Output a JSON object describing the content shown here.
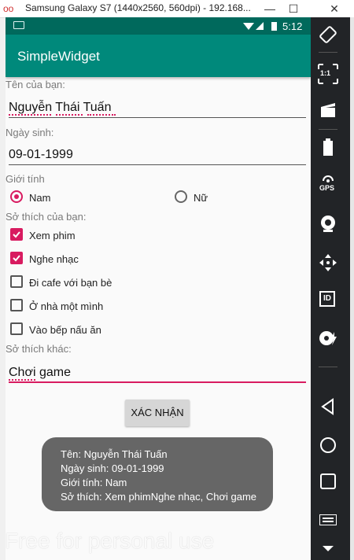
{
  "window": {
    "title": "Samsung Galaxy S7 (1440x2560, 560dpi) - 192.168...",
    "logo": "oo",
    "minimize": "—",
    "maximize": "☐",
    "close": "✕"
  },
  "statusbar": {
    "time": "5:12",
    "icons": "▼◢ ▮"
  },
  "appbar": {
    "title": "SimpleWidget"
  },
  "form": {
    "name_label": "Tên của bạn:",
    "name_value": "Nguyễn Thái Tuấn",
    "dob_label": "Ngày sinh:",
    "dob_value": "09-01-1999",
    "gender_label": "Giới tính",
    "gender_options": [
      {
        "label": "Nam",
        "checked": true
      },
      {
        "label": "Nữ",
        "checked": false
      }
    ],
    "hobbies_label": "Sở thích của bạn:",
    "hobbies": [
      {
        "label": "Xem phim",
        "checked": true
      },
      {
        "label": "Nghe nhạc",
        "checked": true
      },
      {
        "label": "Đi cafe với bạn bè",
        "checked": false
      },
      {
        "label": "Ở nhà một mình",
        "checked": false
      },
      {
        "label": "Vào bếp nấu ăn",
        "checked": false
      }
    ],
    "other_label": "Sở thích khác:",
    "other_value": "Chơi game",
    "submit_label": "XÁC NHẬN"
  },
  "toast": {
    "line1": "Tên: Nguyễn Thái Tuấn",
    "line2": "Ngày sinh: 09-01-1999",
    "line3": "Giới tính: Nam",
    "line4": "Sở thích: Xem phimNghe nhạc, Chơi game"
  },
  "watermark": "Free for personal use",
  "panel": {
    "icons": [
      "rotate-icon",
      "fullscreen-icon",
      "screenrecord-icon",
      "battery-icon",
      "gps-icon",
      "camera-icon",
      "move-icon",
      "id-icon",
      "disk-icon",
      "back-icon",
      "home-icon",
      "recents-icon",
      "menu-icon"
    ],
    "gps_text": "GPS",
    "id_text": "ID",
    "scale_text": "1:1"
  }
}
